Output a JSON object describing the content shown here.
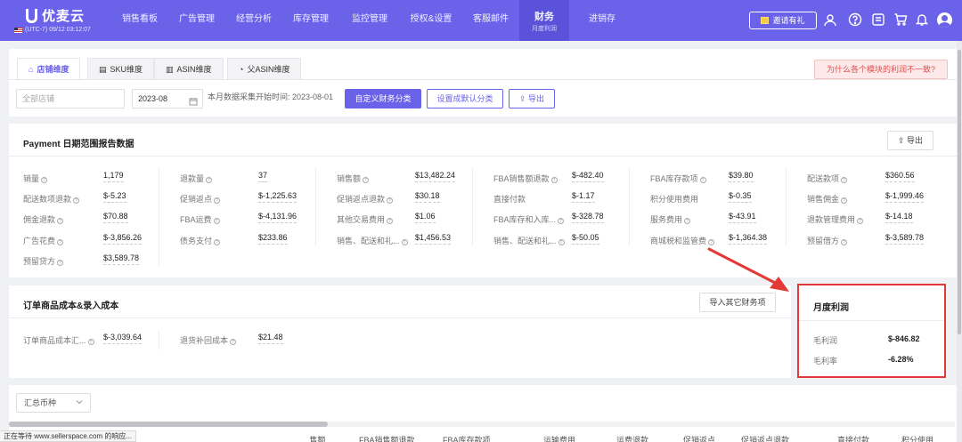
{
  "app": {
    "brand": "优麦云",
    "timezone": "(UTC-7) 09/12 03:12:07",
    "nav": [
      {
        "label": "销售看板"
      },
      {
        "label": "广告管理"
      },
      {
        "label": "经营分析"
      },
      {
        "label": "库存管理"
      },
      {
        "label": "监控管理"
      },
      {
        "label": "授权&设置"
      },
      {
        "label": "客服邮件"
      },
      {
        "label": "财务",
        "sub": "月度利润",
        "active": true
      },
      {
        "label": "进销存"
      }
    ],
    "invite": "邀请有礼",
    "icons": [
      "headset-icon",
      "help-icon",
      "message-icon",
      "cart-icon",
      "bell-icon",
      "avatar"
    ]
  },
  "tabs": [
    {
      "label": "店铺维度",
      "icon": "shop-icon",
      "active": true
    },
    {
      "label": "SKU维度",
      "icon": "sku-icon"
    },
    {
      "label": "ASIN维度",
      "icon": "bar-chart-icon"
    },
    {
      "label": "父ASIN维度",
      "icon": "pie-chart-icon"
    }
  ],
  "why_button": "为什么各个模块的利润不一致?",
  "filters": {
    "shop_placeholder": "全部店铺",
    "month": "2023-08",
    "collect_note": "本月数据采集开始时间: 2023-08-01",
    "custom_btn": "自定义财务分类",
    "default_btn": "设置成默认分类",
    "export_btn": "导出"
  },
  "payment": {
    "title": "Payment 日期范围报告数据",
    "export": "导出",
    "columns": [
      [
        {
          "label": "销量",
          "help": true,
          "value": "1,179"
        },
        {
          "label": "配送数项退款",
          "help": true,
          "value": "$-5.23"
        },
        {
          "label": "佣金退款",
          "help": true,
          "value": "$70.88"
        },
        {
          "label": "广告花费",
          "help": true,
          "value": "$-3,856.26"
        },
        {
          "label": "预留贷方",
          "help": true,
          "value": "$3,589.78"
        }
      ],
      [
        {
          "label": "退款量",
          "help": true,
          "value": "37"
        },
        {
          "label": "促销返点",
          "help": true,
          "value": "$-1,225.63"
        },
        {
          "label": "FBA运费",
          "help": true,
          "value": "$-4,131.96"
        },
        {
          "label": "债务支付",
          "help": true,
          "value": "$233.86"
        }
      ],
      [
        {
          "label": "销售额",
          "help": true,
          "value": "$13,482.24"
        },
        {
          "label": "促销返点退款",
          "help": true,
          "value": "$30.18"
        },
        {
          "label": "其他交易费用",
          "help": true,
          "value": "$1.06"
        },
        {
          "label": "销售、配送和礼...",
          "help": true,
          "value": "$1,456.53"
        }
      ],
      [
        {
          "label": "FBA销售额退款",
          "help": true,
          "value": "$-482.40"
        },
        {
          "label": "直接付款",
          "help": false,
          "value": "$-1.17"
        },
        {
          "label": "FBA库存和入库...",
          "help": true,
          "value": "$-328.78"
        },
        {
          "label": "销售、配送和礼...",
          "help": true,
          "value": "$-50.05"
        }
      ],
      [
        {
          "label": "FBA库存款项",
          "help": true,
          "value": "$39.80"
        },
        {
          "label": "积分使用费用",
          "help": false,
          "value": "$-0.35"
        },
        {
          "label": "服务费用",
          "help": true,
          "value": "$-43.91"
        },
        {
          "label": "商城税和监管费",
          "help": true,
          "value": "$-1,364.38"
        }
      ],
      [
        {
          "label": "配送款项",
          "help": true,
          "value": "$360.56"
        },
        {
          "label": "销售佣金",
          "help": true,
          "value": "$-1,999.46"
        },
        {
          "label": "退款管理费用",
          "help": true,
          "value": "$-14.18"
        },
        {
          "label": "预留借方",
          "help": true,
          "value": "$-3,589.78"
        }
      ]
    ]
  },
  "cost": {
    "title": "订单商品成本&录入成本",
    "import_btn": "导入其它财务项",
    "items": [
      {
        "label": "订单商品成本汇...",
        "help": true,
        "value": "$-3,039.64"
      },
      {
        "label": "退货补回成本",
        "help": true,
        "value": "$21.48"
      }
    ]
  },
  "profit": {
    "title": "月度利润",
    "gross_label": "毛利润",
    "gross_value": "$-846.82",
    "rate_label": "毛利率",
    "rate_value": "-6.28%"
  },
  "summary": {
    "currency_select": "汇总币种"
  },
  "table_headers": [
    "...售额",
    "FBA销售额退款",
    "FBA库存款项",
    "运输费用",
    "运费退款",
    "促销返点",
    "促销返点退款",
    "直接付款",
    "积分使用..."
  ],
  "statusbar": "正在等待 www.sellerspace.com 的响应..."
}
